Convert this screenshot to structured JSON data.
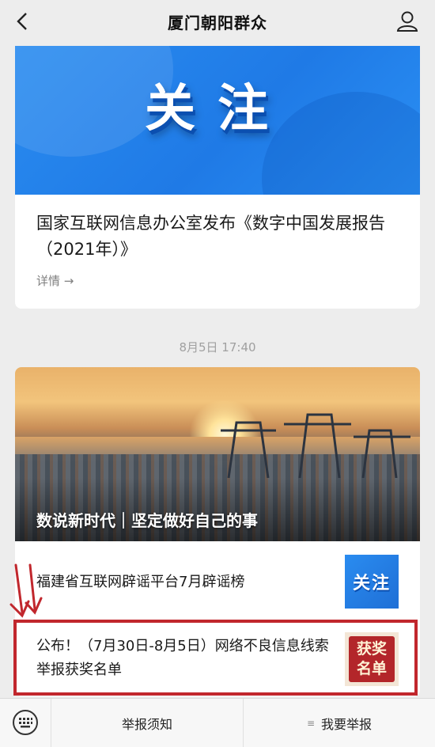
{
  "header": {
    "title": "厦门朝阳群众"
  },
  "card1": {
    "banner_text": "关注",
    "title": "国家互联网信息办公室发布《数字中国发展报告（2021年）》",
    "link": "详情 →"
  },
  "timestamp": "8月5日 17:40",
  "card2": {
    "cover_caption": "数说新时代｜坚定做好自己的事",
    "items": [
      {
        "title": "福建省互联网辟谣平台7月辟谣榜",
        "thumb_text": "关注"
      },
      {
        "title": "公布！（7月30日-8月5日）网络不良信息线索举报获奖名单",
        "thumb_line1": "获奖",
        "thumb_line2": "名单"
      }
    ]
  },
  "bottom_menu": {
    "left": "举报须知",
    "right": "我要举报"
  },
  "colors": {
    "background": "#ededed",
    "blue": "#2a8cf0",
    "highlight_red": "#c1272d",
    "card": "#ffffff"
  },
  "icons": [
    "back-arrow-icon",
    "user-icon",
    "keyboard-icon",
    "menu-lines-icon",
    "red-arrows-annotation"
  ]
}
